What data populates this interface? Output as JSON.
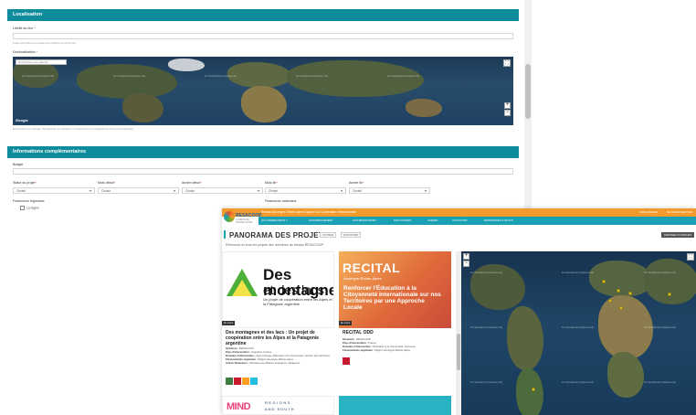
{
  "form": {
    "sections": {
      "localisation": "Localisation",
      "infos": "Informations complémentaires"
    },
    "fields": {
      "libelle_label": "Libellé du lieu",
      "libelle_help": "Cette information sert seulement à afficher le lieu/le titre",
      "geoloc_label": "Géolocalisation",
      "map_search_placeholder": "Rechercher une adresse",
      "map_hint": "Recherchez une adresse \"Rechercher une adresse\" et sélectionnez ou manipulez la carte pour la délimiter",
      "budget_label": "Budget",
      "statut_label": "Statut du projet",
      "mois_debut_label": "Mois début",
      "annee_debut_label": "Année début",
      "mois_fin_label": "Mois fin",
      "annee_fin_label": "Année fin",
      "select_placeholder": "Choisir",
      "financeurs_regionaux": "Financeurs régionaux",
      "financeurs_nationaux": "Financeurs nationaux",
      "option_region": "La région",
      "required_mark": "*"
    },
    "map": {
      "google_label": "Google",
      "watermark": "For development purposes only",
      "zoom_in": "+",
      "zoom_out": "−",
      "fullscreen": "⛶"
    }
  },
  "site": {
    "logo_title": "RESACOOP",
    "logo_subtitle": "AUVERGNE-RHÔNE-ALPES",
    "topbar_title": "Réseau Auvergne-Rhône-Alpes d'appui à la Coopération Internationale",
    "topbar_right": [
      "MON ESPACE",
      "SE DÉCONNECTER"
    ],
    "nav": [
      "QUI SOMMES-NOUS ?",
      "ACCOMPAGNEMENT",
      "NOS RESSOURCES",
      "NOS ACTEURS",
      "AGENDA",
      "ACTUALITÉS",
      "RESSOURCES & OUTILS"
    ],
    "page_title": "PANORAMA DES PROJETS",
    "btn_filter": "FILTRER",
    "btn_export": "EXPORTER",
    "btn_add": "DÉPOSER UN PROJET",
    "subtitle": "Retrouvez ici tous les projets des membres du réseau RESACOOP"
  },
  "cards": [
    {
      "img_title_1": "Des montagnes",
      "img_title_2": "et des lacs",
      "img_caption": "Un projet de coopération entre les Alpes et la Patagonie argentine",
      "tag": "En cours",
      "title": "Des montagnes et des lacs : Un projet de coopération entre les Alpes et la Patagonie argentine",
      "meta": [
        {
          "k": "Structure :",
          "v": "RESACOOP"
        },
        {
          "k": "Pays d'intervention :",
          "v": "Argentine, France"
        },
        {
          "k": "Domaine d'intervention :",
          "v": "Agro-écologie, Éducation à la citoyenneté, Gestion des territoires"
        },
        {
          "k": "Financements régionaux :",
          "v": "Région Auvergne-Rhône-Alpes"
        },
        {
          "k": "Autres financeurs :",
          "v": "Ministère des Affaires étrangères, Patagonie"
        }
      ]
    },
    {
      "img_title_1": "RECITAL",
      "img_subtitle": "Auvergne-Rhône-Alpes",
      "img_tagline": "Renforcer l'Éducation à la Citoyenneté Internationale sur nos Territoires par une Approche Locale",
      "tag": "En cours",
      "title": "RECITAL ODD",
      "meta": [
        {
          "k": "Structure :",
          "v": "RESACOOP"
        },
        {
          "k": "Pays d'intervention :",
          "v": "France"
        },
        {
          "k": "Domaine d'intervention :",
          "v": "Éducation à la citoyenneté, Jeunesse"
        },
        {
          "k": "Financements régionaux :",
          "v": "Région Auvergne-Rhône-Alpes"
        }
      ]
    },
    {
      "img_title_1": "MIND",
      "img_line_1": "REGIONS",
      "img_line_2": "AND SOUTH"
    }
  ],
  "colors": {
    "teal": "#0e8c9c",
    "orange": "#f29b2c",
    "nav_teal": "#1aa0b5",
    "pin": "#f2d22a"
  }
}
